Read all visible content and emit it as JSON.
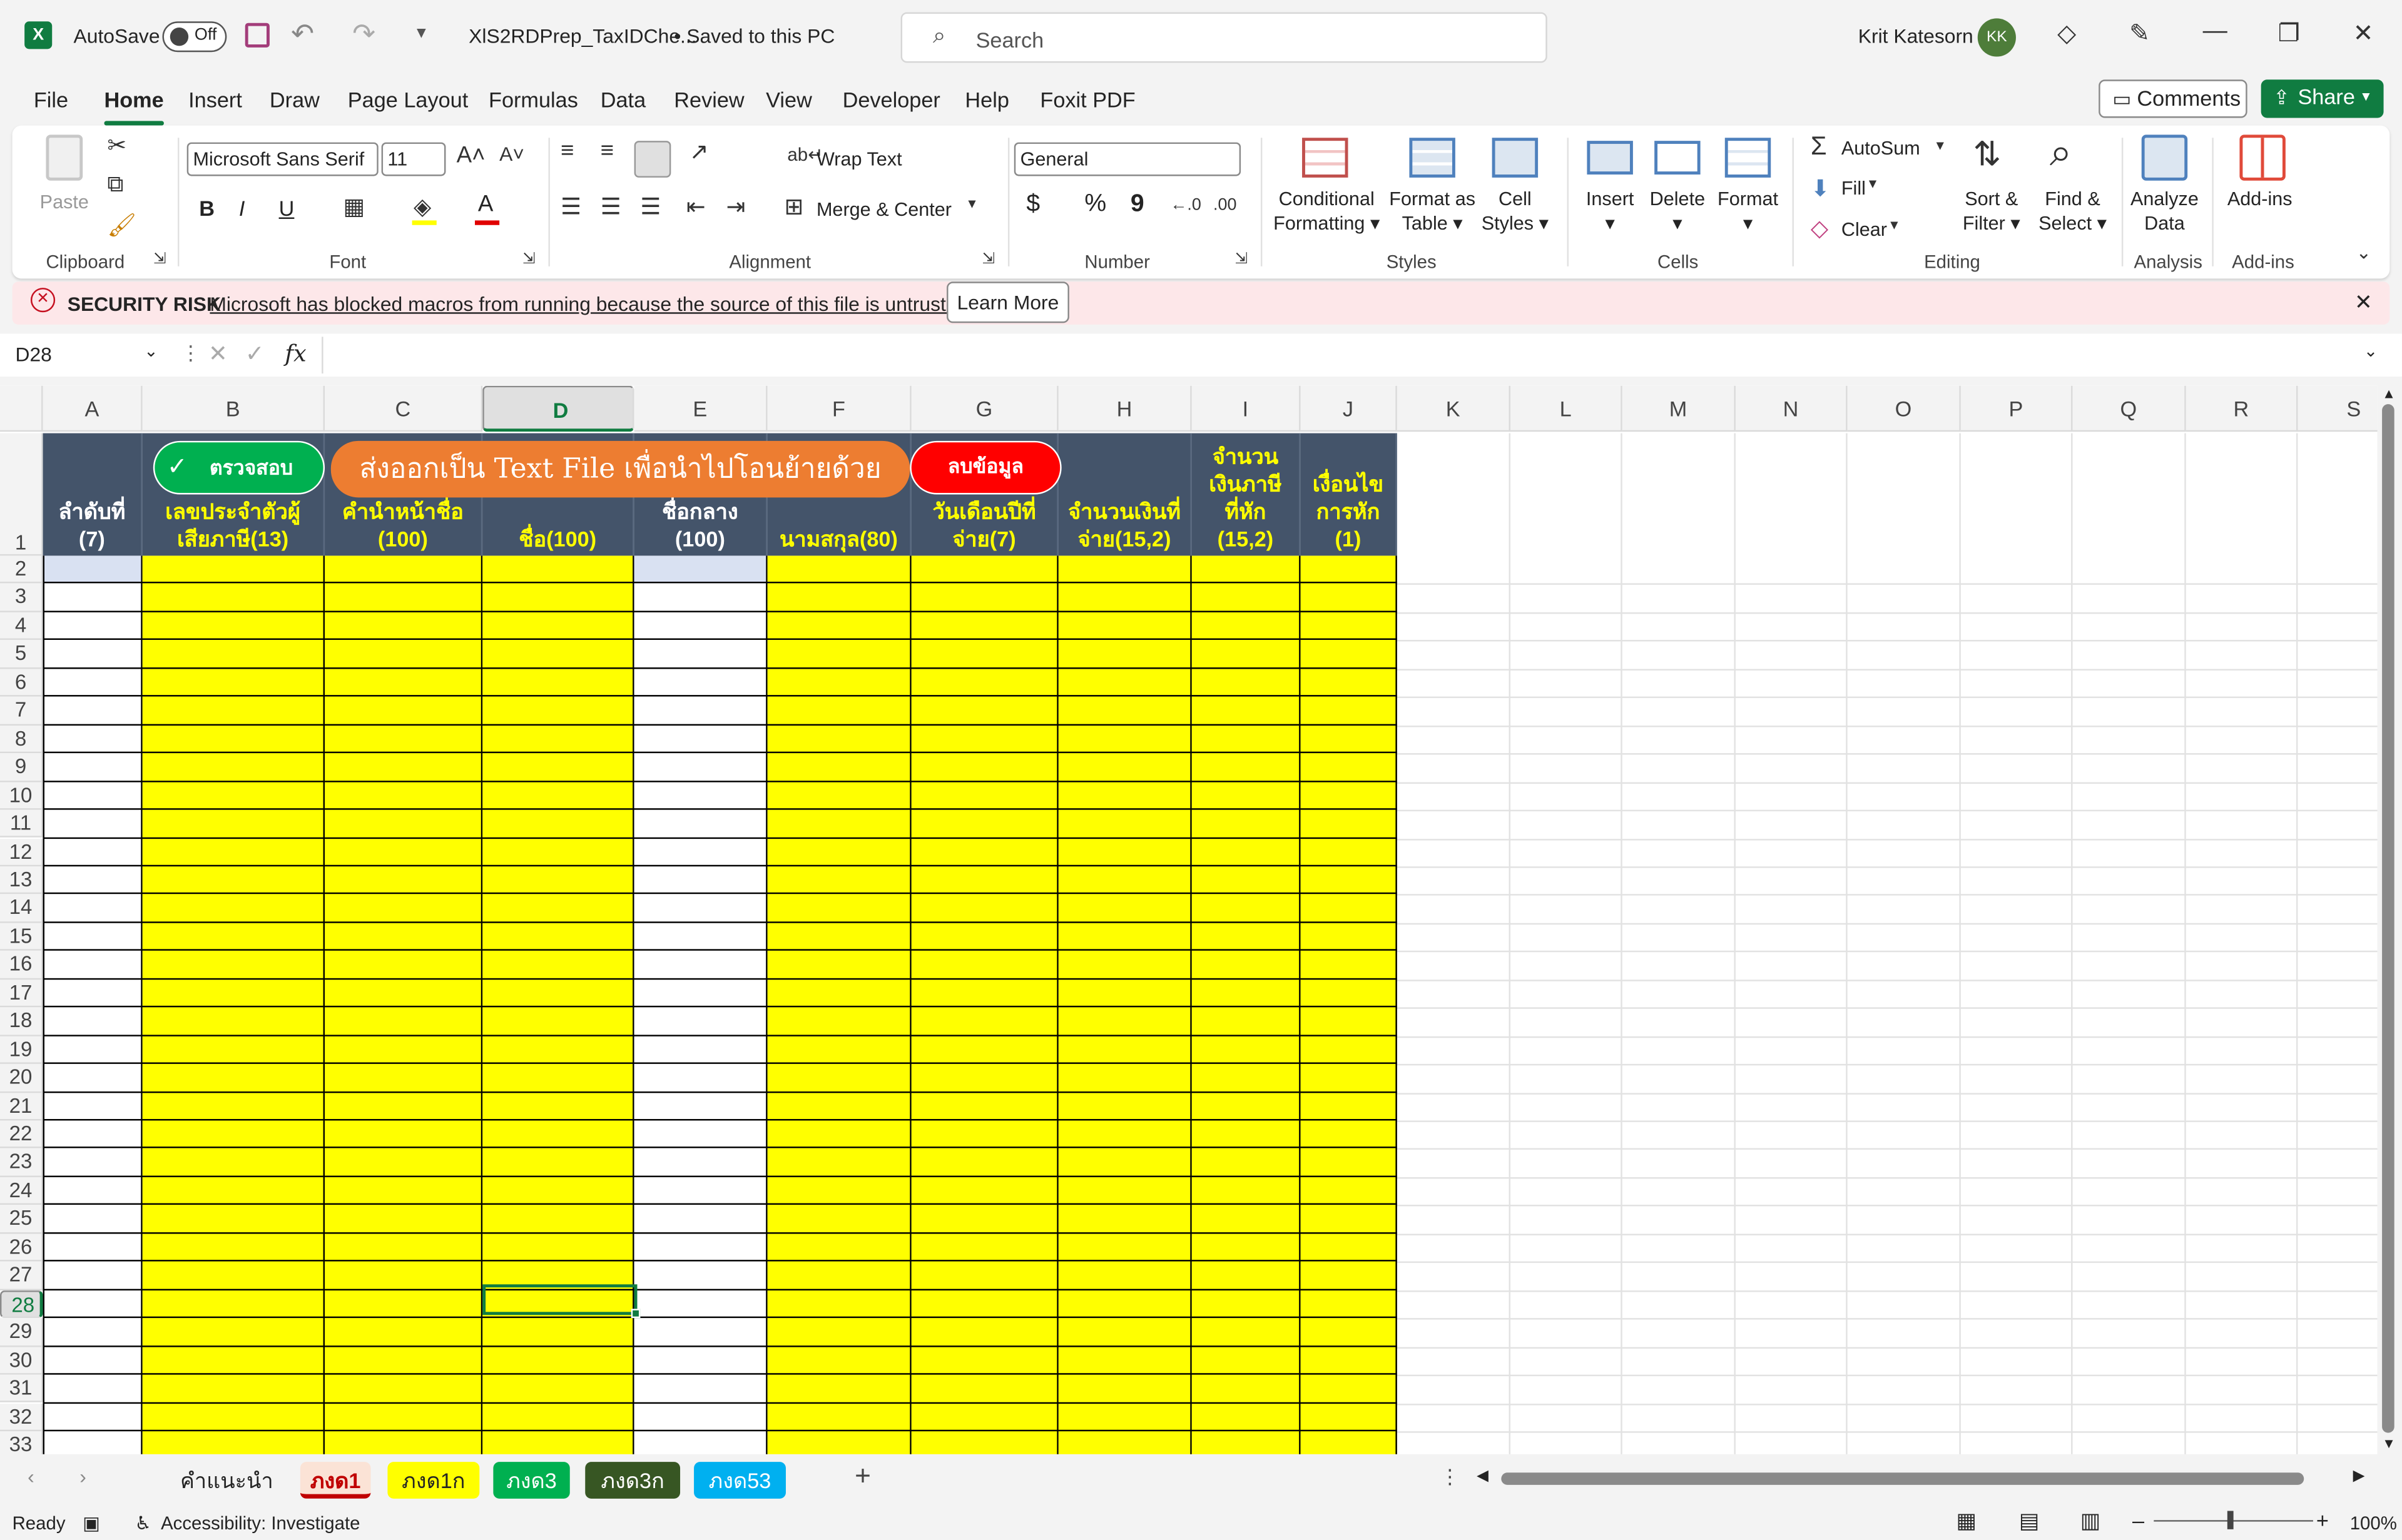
{
  "titlebar": {
    "autosave_label": "AutoSave",
    "autosave_state": "Off",
    "filename": "XlS2RDPrep_TaxIDChe...",
    "save_status": "• Saved to this PC",
    "search_placeholder": "Search",
    "user_name": "Krit Katesorn",
    "user_initials": "KK"
  },
  "menu": {
    "items": [
      "File",
      "Home",
      "Insert",
      "Draw",
      "Page Layout",
      "Formulas",
      "Data",
      "Review",
      "View",
      "Developer",
      "Help",
      "Foxit PDF"
    ],
    "active": "Home",
    "comments_label": "Comments",
    "share_label": "Share"
  },
  "ribbon": {
    "clipboard": {
      "paste": "Paste",
      "label": "Clipboard"
    },
    "font": {
      "family": "Microsoft Sans Serif",
      "size": "11",
      "label": "Font",
      "bold": "B",
      "italic": "I",
      "underline": "U"
    },
    "alignment": {
      "wrap_text": "Wrap Text",
      "merge_center": "Merge & Center",
      "label": "Alignment"
    },
    "number": {
      "format": "General",
      "label": "Number",
      "currency": "$",
      "percent": "%",
      "comma": "9"
    },
    "styles": {
      "conditional": [
        "Conditional",
        "Formatting"
      ],
      "format_table": [
        "Format as",
        "Table"
      ],
      "cell_styles": [
        "Cell",
        "Styles"
      ],
      "label": "Styles"
    },
    "cells": {
      "insert": "Insert",
      "delete": "Delete",
      "format": "Format",
      "label": "Cells"
    },
    "editing": {
      "autosum": "AutoSum",
      "fill": "Fill",
      "clear": "Clear",
      "sort_filter": [
        "Sort &",
        "Filter"
      ],
      "find_select": [
        "Find &",
        "Select"
      ],
      "label": "Editing"
    },
    "analysis": {
      "analyze": [
        "Analyze",
        "Data"
      ],
      "label": "Analysis"
    },
    "addins": {
      "addins": "Add-ins",
      "label": "Add-ins"
    }
  },
  "security": {
    "title": "SECURITY RISK",
    "message": "Microsoft has blocked macros from running because the source of this file is untrusted.",
    "learn_more": "Learn More"
  },
  "formula_bar": {
    "name_box": "D28",
    "fx": "fx",
    "value": ""
  },
  "sheet": {
    "columns": [
      "A",
      "B",
      "C",
      "D",
      "E",
      "F",
      "G",
      "H",
      "I",
      "J",
      "K",
      "L",
      "M",
      "N",
      "O",
      "P",
      "Q",
      "R",
      "S"
    ],
    "selected_column": "D",
    "rows": [
      "1",
      "2",
      "3",
      "4",
      "5",
      "6",
      "7",
      "8",
      "9",
      "10",
      "11",
      "12",
      "13",
      "14",
      "15",
      "16",
      "17",
      "18",
      "19",
      "20",
      "21",
      "22",
      "23",
      "24",
      "25",
      "26",
      "27",
      "28",
      "29",
      "30",
      "31",
      "32",
      "33"
    ],
    "selected_row": "28",
    "headers": [
      {
        "col": "A",
        "lines": [
          "ลำดับที่",
          "(7)"
        ]
      },
      {
        "col": "B",
        "lines": [
          "เลขประจำตัวผู้",
          "เสียภาษี(13)"
        ]
      },
      {
        "col": "C",
        "lines": [
          "คำนำหน้าชื่อ",
          "(100)"
        ]
      },
      {
        "col": "D",
        "lines": [
          "ชื่อ(100)"
        ]
      },
      {
        "col": "E",
        "lines": [
          "ชื่อกลาง",
          "(100)"
        ]
      },
      {
        "col": "F",
        "lines": [
          "นามสกุล(80)"
        ]
      },
      {
        "col": "G",
        "lines": [
          "วันเดือนปีที่",
          "จ่าย(7)"
        ]
      },
      {
        "col": "H",
        "lines": [
          "จำนวนเงินที่",
          "จ่าย(15,2)"
        ]
      },
      {
        "col": "I",
        "lines": [
          "จำนวน",
          "เงินภาษี",
          "ที่หัก",
          "(15,2)"
        ]
      },
      {
        "col": "J",
        "lines": [
          "เงื่อนไข",
          "การหัก",
          "(1)"
        ]
      }
    ],
    "buttons": {
      "check": "ตรวจสอบ",
      "export": "ส่งออกเป็น Text File เพื่อนำไปโอนย้ายด้วย",
      "clear": "ลบข้อมูล"
    }
  },
  "sheet_tabs": [
    {
      "name": "คำแนะนำ",
      "color": "#f3f3f3",
      "text": "#242424"
    },
    {
      "name": "ภงด1",
      "color": "#fbe3d6",
      "text": "#c00000",
      "active": true
    },
    {
      "name": "ภงด1ก",
      "color": "#ffff00",
      "text": "#242424"
    },
    {
      "name": "ภงด3",
      "color": "#00b050",
      "text": "#ffffff"
    },
    {
      "name": "ภงด3ก",
      "color": "#375623",
      "text": "#ffffff"
    },
    {
      "name": "ภงด53",
      "color": "#00b0f0",
      "text": "#ffffff"
    }
  ],
  "status": {
    "ready": "Ready",
    "accessibility": "Accessibility: Investigate",
    "zoom": "100%"
  },
  "colors": {
    "excel_green": "#107c41",
    "header_bg": "#44546a",
    "input_yellow": "#ffff00"
  }
}
